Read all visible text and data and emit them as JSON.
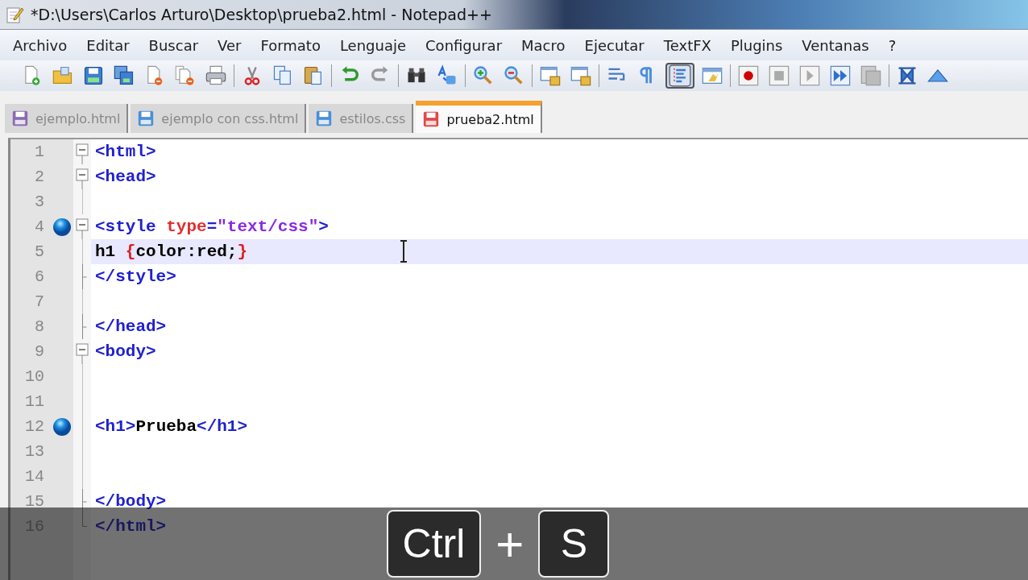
{
  "window": {
    "title": "*D:\\Users\\Carlos Arturo\\Desktop\\prueba2.html - Notepad++"
  },
  "menu": [
    "Archivo",
    "Editar",
    "Buscar",
    "Ver",
    "Formato",
    "Lenguaje",
    "Configurar",
    "Macro",
    "Ejecutar",
    "TextFX",
    "Plugins",
    "Ventanas",
    "?"
  ],
  "tabs": [
    {
      "label": "ejemplo.html",
      "selected": false,
      "color": "#8a6bb0"
    },
    {
      "label": "ejemplo con css.html",
      "selected": false,
      "color": "#4a8fd8"
    },
    {
      "label": "estilos.css",
      "selected": false,
      "color": "#4a8fd8"
    },
    {
      "label": "prueba2.html",
      "selected": true,
      "color": "#e04848"
    }
  ],
  "editor": {
    "lines": [
      {
        "number": "1",
        "fold_start": true,
        "fold_end": false,
        "bookmark": false,
        "current": false,
        "tokens": [
          {
            "kind": "tag",
            "text": "<html>"
          }
        ]
      },
      {
        "number": "2",
        "fold_start": true,
        "fold_end": false,
        "bookmark": false,
        "current": false,
        "tokens": [
          {
            "kind": "tag",
            "text": "<head>"
          }
        ]
      },
      {
        "number": "3",
        "fold_start": false,
        "fold_end": false,
        "bookmark": false,
        "current": false
      },
      {
        "number": "4",
        "fold_start": true,
        "fold_end": false,
        "bookmark": true,
        "current": false,
        "tokens": [
          {
            "kind": "tag",
            "text": "<style "
          },
          {
            "kind": "attr",
            "text": "type"
          },
          {
            "kind": "tag",
            "text": "="
          },
          {
            "kind": "value",
            "text": "\"text/css\""
          },
          {
            "kind": "tag",
            "text": ">"
          }
        ]
      },
      {
        "number": "5",
        "fold_start": false,
        "fold_end": false,
        "bookmark": false,
        "current": true,
        "tokens": [
          {
            "kind": "text",
            "text": "h1 "
          },
          {
            "kind": "brace",
            "text": "{"
          },
          {
            "kind": "text",
            "text": "color:red;"
          },
          {
            "kind": "brace",
            "text": "}"
          }
        ]
      },
      {
        "number": "6",
        "fold_start": false,
        "fold_end": true,
        "bookmark": false,
        "current": false,
        "tokens": [
          {
            "kind": "tag",
            "text": "</style>"
          }
        ]
      },
      {
        "number": "7",
        "fold_start": false,
        "fold_end": false,
        "bookmark": false,
        "current": false
      },
      {
        "number": "8",
        "fold_start": false,
        "fold_end": true,
        "bookmark": false,
        "current": false,
        "tokens": [
          {
            "kind": "tag",
            "text": "</head>"
          }
        ]
      },
      {
        "number": "9",
        "fold_start": true,
        "fold_end": false,
        "bookmark": false,
        "current": false,
        "tokens": [
          {
            "kind": "tag",
            "text": "<body>"
          }
        ]
      },
      {
        "number": "10",
        "fold_start": false,
        "fold_end": false,
        "bookmark": false,
        "current": false
      },
      {
        "number": "11",
        "fold_start": false,
        "fold_end": false,
        "bookmark": false,
        "current": false
      },
      {
        "number": "12",
        "fold_start": false,
        "fold_end": false,
        "bookmark": true,
        "current": false,
        "tokens": [
          {
            "kind": "tag",
            "text": "<h1>"
          },
          {
            "kind": "text",
            "text": "Prueba"
          },
          {
            "kind": "tag",
            "text": "</h1>"
          }
        ]
      },
      {
        "number": "13",
        "fold_start": false,
        "fold_end": false,
        "bookmark": false,
        "current": false
      },
      {
        "number": "14",
        "fold_start": false,
        "fold_end": false,
        "bookmark": false,
        "current": false
      },
      {
        "number": "15",
        "fold_start": false,
        "fold_end": true,
        "bookmark": false,
        "current": false,
        "tokens": [
          {
            "kind": "tag",
            "text": "</body>"
          }
        ]
      },
      {
        "number": "16",
        "fold_start": false,
        "fold_end": true,
        "bookmark": false,
        "current": false,
        "tokens": [
          {
            "kind": "tag",
            "text": "</html>"
          }
        ]
      }
    ]
  },
  "keystroke": [
    {
      "kind": "key",
      "text": "Ctrl"
    },
    {
      "kind": "plus",
      "text": "+"
    },
    {
      "kind": "key",
      "text": "S"
    }
  ]
}
